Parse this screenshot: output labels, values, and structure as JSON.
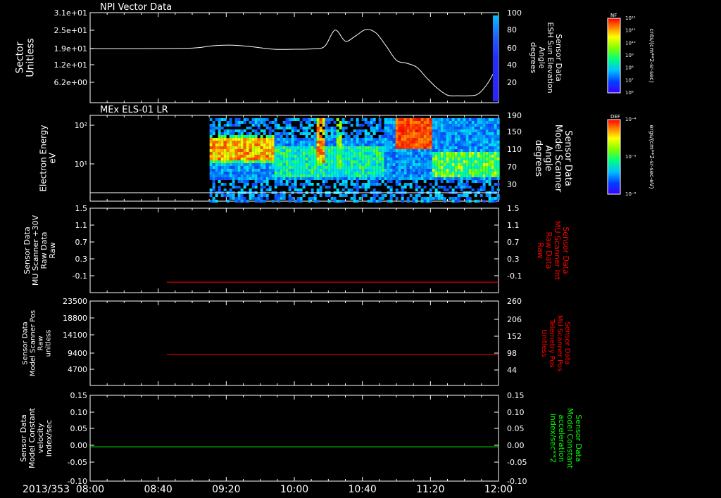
{
  "date_label": "2013/353",
  "time_ticks": [
    "08:00",
    "08:40",
    "09:20",
    "10:00",
    "10:40",
    "11:20",
    "12:00"
  ],
  "panels": [
    {
      "id": "p1",
      "title": "NPI Vector Data",
      "left_label": [
        "Sector",
        "Unitless"
      ],
      "left_ticks": [
        "3.1e+01",
        "2.5e+01",
        "1.9e+01",
        "1.2e+01",
        "6.2e+00"
      ],
      "right_label": [
        "Sensor Data",
        "ESH Sun Elevation",
        "Angle",
        "degrees"
      ],
      "right_ticks": [
        "100",
        "80",
        "60",
        "40",
        "20"
      ]
    },
    {
      "id": "p2",
      "title": "MEx ELS-01 LR",
      "left_label": [
        "Electron Energy",
        "eV"
      ],
      "left_ticks": [
        "10²",
        "10¹"
      ],
      "right_label": [
        "Sensor Data",
        "Model Scanner",
        "Angle",
        "degrees"
      ],
      "right_ticks": [
        "190",
        "150",
        "110",
        "70",
        "30"
      ]
    },
    {
      "id": "p3",
      "left_label": [
        "Sensor Data",
        "MU Scanner +30V",
        "Raw Data",
        "Raw"
      ],
      "left_ticks": [
        "1.5",
        "1.1",
        "0.7",
        "0.3",
        "-0.1"
      ],
      "right_label": [
        "Sensor Data",
        "MU Scanner Int",
        "Raw Data",
        "Raw"
      ],
      "right_ticks": [
        "1.5",
        "1.1",
        "0.7",
        "0.3",
        "-0.1"
      ]
    },
    {
      "id": "p4",
      "left_label": [
        "Sensor Data",
        "Model Scanner Pos",
        "Raw",
        "unitless"
      ],
      "left_ticks": [
        "23500",
        "18800",
        "14100",
        "9400",
        "4700"
      ],
      "right_label": [
        "Sensor Data",
        "MU Scanner Pos",
        "Telemetry Pos",
        "Unitless"
      ],
      "right_ticks": [
        "260",
        "206",
        "152",
        "98",
        "44"
      ]
    },
    {
      "id": "p5",
      "left_label": [
        "Sensor Data",
        "Model Constant",
        "velocity",
        "index/sec"
      ],
      "left_ticks": [
        "0.15",
        "0.10",
        "0.05",
        "0.00",
        "-0.05",
        "-0.10"
      ],
      "right_label": [
        "Sensor Data",
        "Model Constant",
        "acceleration",
        "index/sec**2"
      ],
      "right_ticks": [
        "0.15",
        "0.10",
        "0.05",
        "0.00",
        "-0.05",
        "-0.10"
      ]
    }
  ],
  "colorbars": [
    {
      "id": "cb1",
      "tag": "NF",
      "unit": "cnts/(cm**2-sr-sec)",
      "ticks": [
        "10¹²",
        "10¹¹",
        "10¹⁰",
        "10⁹",
        "10⁸",
        "10⁷",
        "10⁶"
      ]
    },
    {
      "id": "cb2",
      "tag": "DEF",
      "unit": "ergs/(cm**2-sr-sec-eV)",
      "ticks": [
        "10⁻⁴",
        "10⁻⁵",
        "10⁻⁶"
      ]
    }
  ],
  "colors": {
    "white": "#ffffff",
    "red": "#ff0000",
    "green": "#00ff00",
    "dark_red": "#cc2222",
    "background": "#000000"
  },
  "chart_data": [
    {
      "type": "line",
      "panel": "p1",
      "x_unit": "hours",
      "xlim": [
        8,
        12
      ],
      "x": [
        8.0,
        8.5,
        9.0,
        9.2,
        9.4,
        9.6,
        9.8,
        10.0,
        10.2,
        10.3,
        10.4,
        10.5,
        10.6,
        10.7,
        10.8,
        10.9,
        11.0,
        11.1,
        11.2,
        11.3,
        11.4,
        11.5,
        11.6,
        11.7,
        11.8,
        11.9,
        12.0
      ],
      "y": [
        18.6,
        18.6,
        18.8,
        19.6,
        19.8,
        19.2,
        18.4,
        18.4,
        18.6,
        19.5,
        25.0,
        21.2,
        23.0,
        25.2,
        24.0,
        19.5,
        14.6,
        13.6,
        12.2,
        8.4,
        5.0,
        2.6,
        2.4,
        2.4,
        3.0,
        7.0,
        13.5
      ],
      "ylim": [
        0,
        31
      ]
    },
    {
      "type": "heatmap",
      "panel": "p2",
      "x_start": 9.17,
      "x_end": 12.0,
      "note_ranges": [
        [
          10.05,
          10.2
        ],
        [
          10.65,
          10.9
        ],
        [
          11.1,
          11.3
        ]
      ]
    },
    {
      "type": "line",
      "panel": "p3",
      "x": [
        8.75,
        12.0
      ],
      "y": [
        -0.12,
        -0.12
      ],
      "ylim": [
        -0.35,
        1.5
      ]
    },
    {
      "type": "line",
      "panel": "p4",
      "x": [
        8.75,
        12.0
      ],
      "y": [
        8600,
        8600
      ],
      "ylim": [
        0,
        23500
      ]
    },
    {
      "type": "line",
      "panel": "p5",
      "x": [
        8.0,
        12.0
      ],
      "y": [
        0.0,
        0.0
      ],
      "ylim": [
        -0.1,
        0.15
      ]
    }
  ]
}
